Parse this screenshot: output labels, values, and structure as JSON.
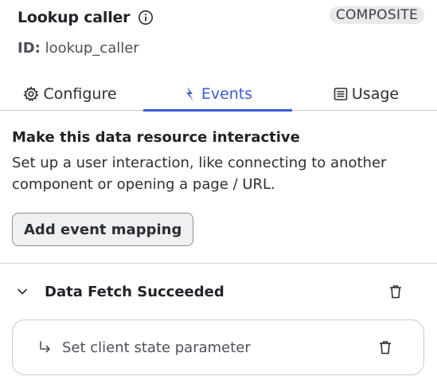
{
  "header": {
    "title": "Lookup caller",
    "badge": "COMPOSITE",
    "id_label": "ID:",
    "id_value": "lookup_caller"
  },
  "tabs": [
    {
      "label": "Configure",
      "icon": "gear-icon",
      "active": false
    },
    {
      "label": "Events",
      "icon": "lightning-icon",
      "active": true
    },
    {
      "label": "Usage",
      "icon": "list-icon",
      "active": false
    }
  ],
  "section": {
    "title": "Make this data resource interactive",
    "description_line1": "Set up a user interaction, like connecting to another",
    "description_line2": "component or opening a page / URL.",
    "add_button": "Add event mapping"
  },
  "event": {
    "title": "Data Fetch Succeeded",
    "action_label": "Set client state parameter"
  },
  "colors": {
    "accent": "#3a5bd6",
    "border": "#c7c9cc",
    "badge_bg": "#e8e9eb"
  }
}
